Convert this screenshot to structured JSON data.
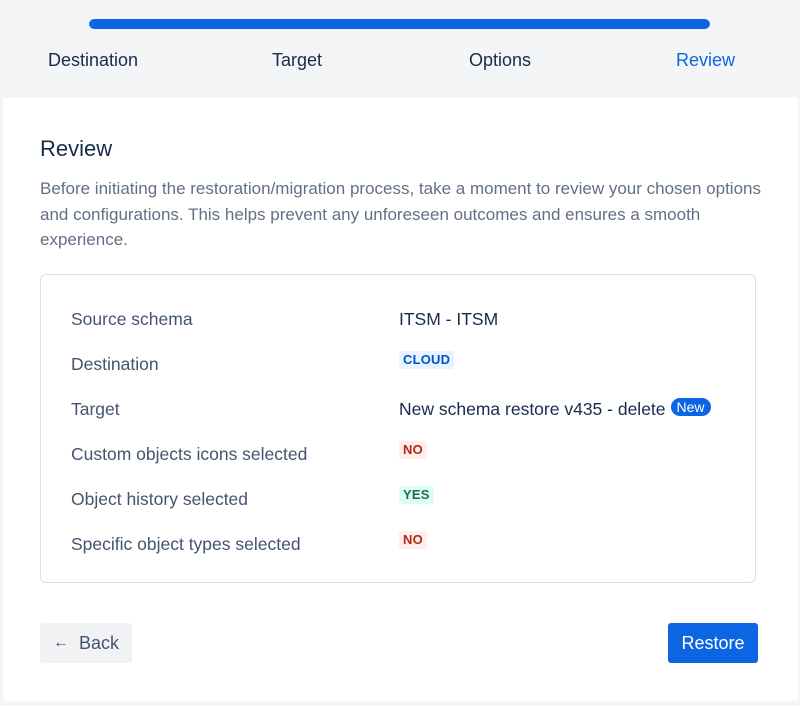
{
  "stepper": {
    "progress_fraction": 1.0,
    "steps": [
      {
        "label": "Destination"
      },
      {
        "label": "Target"
      },
      {
        "label": "Options"
      },
      {
        "label": "Review"
      }
    ],
    "active_step": "Review"
  },
  "review": {
    "title": "Review",
    "description": "Before initiating the restoration/migration process, take a moment to review your chosen options and configurations. This helps prevent any unforeseen outcomes and ensures a smooth experience."
  },
  "summary": {
    "rows": [
      {
        "label": "Source schema",
        "value": "ITSM - ITSM"
      },
      {
        "label": "Destination",
        "value": "CLOUD"
      },
      {
        "label": "Target",
        "value": "New schema restore v435 - delete",
        "badge": "New"
      },
      {
        "label": "Custom objects icons selected",
        "value": "NO"
      },
      {
        "label": "Object history selected",
        "value": "YES"
      },
      {
        "label": "Specific object types selected",
        "value": "NO"
      }
    ]
  },
  "actions": {
    "back_label": "Back",
    "back_icon": "arrow-left-icon",
    "restore_label": "Restore"
  },
  "colors": {
    "accent": "#0C66E4",
    "lozenge_blue_bg": "#E9F2FF",
    "lozenge_red_bg": "#FFECEB",
    "lozenge_green_bg": "#DCFFF1"
  }
}
